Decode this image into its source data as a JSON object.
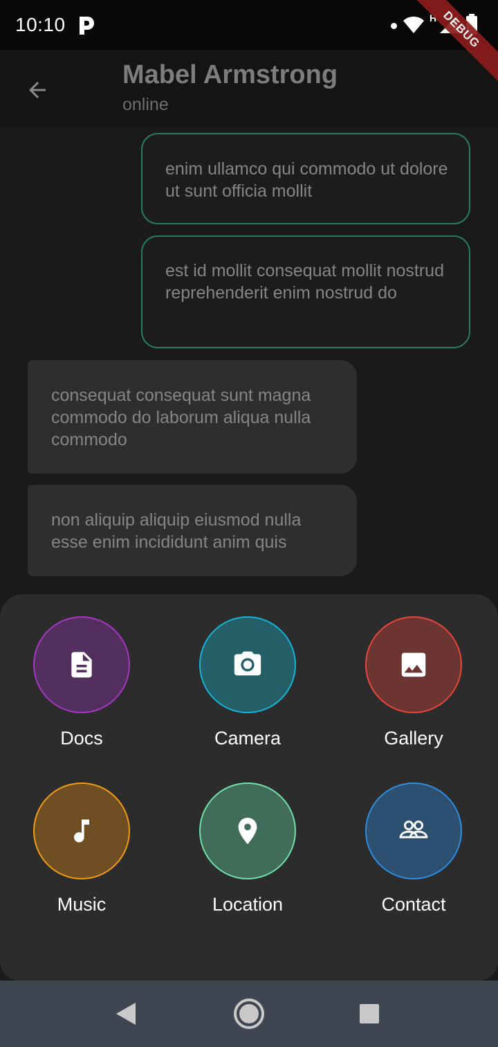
{
  "status_bar": {
    "time": "10:10",
    "network_label": "H",
    "debug_label": "DEBUG"
  },
  "chat": {
    "contact_name": "Mabel Armstrong",
    "contact_status": "online"
  },
  "messages": [
    {
      "direction": "sent",
      "text": "enim ullamco qui commodo ut dolore ut sunt officia mollit"
    },
    {
      "direction": "sent",
      "text": "est id mollit consequat mollit nostrud reprehenderit enim nostrud do"
    },
    {
      "direction": "received",
      "text": "consequat consequat sunt magna commodo do laborum aliqua nulla commodo"
    },
    {
      "direction": "received",
      "text": "non aliquip aliquip eiusmod nulla esse enim incididunt anim quis"
    }
  ],
  "attachments": [
    {
      "label": "Docs",
      "icon": "document-icon",
      "bg": "#532f5f",
      "border": "#a438c2"
    },
    {
      "label": "Camera",
      "icon": "camera-icon",
      "bg": "#245e67",
      "border": "#14b4d4"
    },
    {
      "label": "Gallery",
      "icon": "image-icon",
      "bg": "#6d3531",
      "border": "#e8453b"
    },
    {
      "label": "Music",
      "icon": "music-note-icon",
      "bg": "#6e4e22",
      "border": "#f39c12"
    },
    {
      "label": "Location",
      "icon": "location-pin-icon",
      "bg": "#426c5a",
      "border": "#6fe0ab"
    },
    {
      "label": "Contact",
      "icon": "people-icon",
      "bg": "#2d5070",
      "border": "#2d8de0"
    }
  ],
  "colors": {
    "sent_border": "#2a7a62",
    "received_bg": "#2e2e2e",
    "sheet_bg": "#2c2c2c",
    "nav_bar_bg": "#3e4651"
  }
}
